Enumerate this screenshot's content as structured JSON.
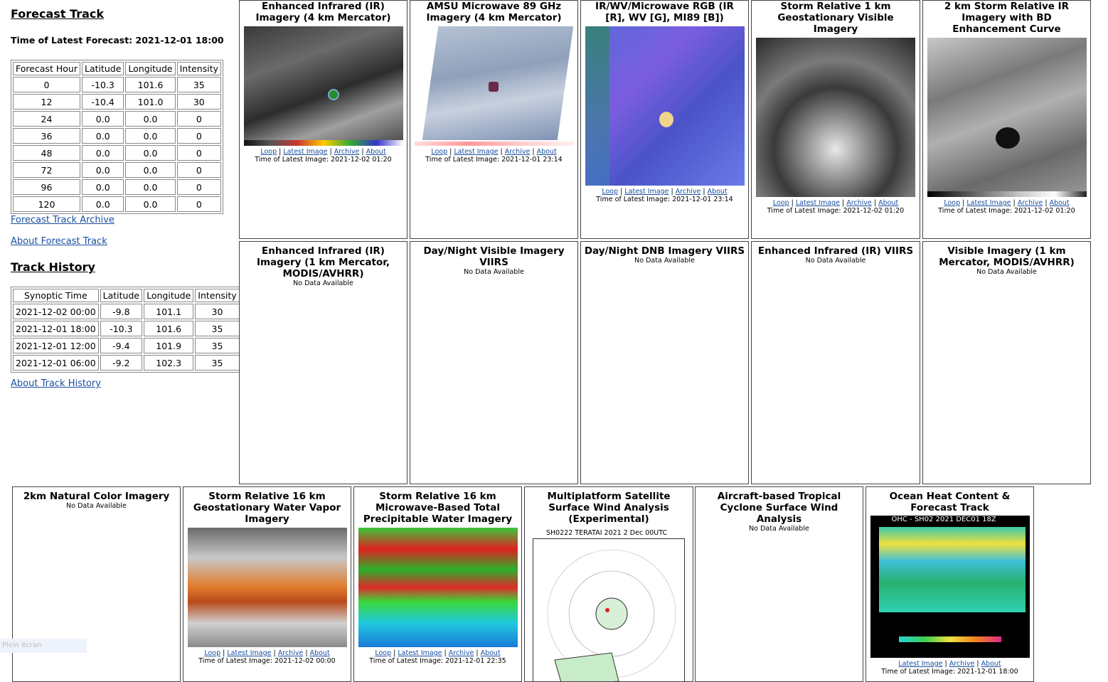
{
  "forecast": {
    "heading": "Forecast Track",
    "time_label": "Time of Latest Forecast: 2021-12-01 18:00",
    "columns": [
      "Forecast Hour",
      "Latitude",
      "Longitude",
      "Intensity"
    ],
    "rows": [
      [
        "0",
        "-10.3",
        "101.6",
        "35"
      ],
      [
        "12",
        "-10.4",
        "101.0",
        "30"
      ],
      [
        "24",
        "0.0",
        "0.0",
        "0"
      ],
      [
        "36",
        "0.0",
        "0.0",
        "0"
      ],
      [
        "48",
        "0.0",
        "0.0",
        "0"
      ],
      [
        "72",
        "0.0",
        "0.0",
        "0"
      ],
      [
        "96",
        "0.0",
        "0.0",
        "0"
      ],
      [
        "120",
        "0.0",
        "0.0",
        "0"
      ]
    ],
    "archive_link": "Forecast Track Archive",
    "about_link": "About Forecast Track"
  },
  "history": {
    "heading": "Track History",
    "columns": [
      "Synoptic Time",
      "Latitude",
      "Longitude",
      "Intensity"
    ],
    "rows": [
      [
        "2021-12-02 00:00",
        "-9.8",
        "101.1",
        "30"
      ],
      [
        "2021-12-01 18:00",
        "-10.3",
        "101.6",
        "35"
      ],
      [
        "2021-12-01 12:00",
        "-9.4",
        "101.9",
        "35"
      ],
      [
        "2021-12-01 06:00",
        "-9.2",
        "102.3",
        "35"
      ]
    ],
    "about_link": "About Track History"
  },
  "links": {
    "loop": "Loop",
    "latest": "Latest Image",
    "archive": "Archive",
    "about": "About",
    "sep": "|"
  },
  "no_data": "No Data Available",
  "panels": [
    {
      "title": "Enhanced Infrared (IR) Imagery (4 km Mercator)",
      "time": "Time of Latest Image: 2021-12-02 01:20"
    },
    {
      "title": "AMSU Microwave 89 GHz Imagery (4 km Mercator)",
      "time": "Time of Latest Image: 2021-12-01 23:14"
    },
    {
      "title": "IR/WV/Microwave RGB (IR [R], WV [G], MI89 [B])",
      "time": "Time of Latest Image: 2021-12-01 23:14"
    },
    {
      "title": "Storm Relative 1 km Geostationary Visible Imagery",
      "time": "Time of Latest Image: 2021-12-02 01:20"
    },
    {
      "title": "2 km Storm Relative IR Imagery with BD Enhancement Curve",
      "time": "Time of Latest Image: 2021-12-02 01:20"
    },
    {
      "title": "Enhanced Infrared (IR) Imagery (1 km Mercator, MODIS/AVHRR)"
    },
    {
      "title": "Day/Night Visible Imagery VIIRS"
    },
    {
      "title": "Day/Night DNB Imagery VIIRS"
    },
    {
      "title": "Enhanced Infrared (IR) VIIRS"
    },
    {
      "title": "Visible Imagery (1 km Mercator, MODIS/AVHRR)"
    },
    {
      "title": "2km Natural Color Imagery"
    },
    {
      "title": "Storm Relative 16 km Geostationary Water Vapor Imagery",
      "time": "Time of Latest Image: 2021-12-02 00:00"
    },
    {
      "title": "Storm Relative 16 km Microwave-Based Total Precipitable Water Imagery",
      "time": "Time of Latest Image: 2021-12-01 22:35"
    },
    {
      "title": "Multiplatform Satellite Surface Wind Analysis (Experimental)",
      "caption": "SH0222    TERATAI  2021   2 Dec 00UTC"
    },
    {
      "title": "Aircraft-based Tropical Cyclone Surface Wind Analysis"
    },
    {
      "title": "Ocean Heat Content & Forecast Track",
      "caption": "OHC - SH02 2021 DEC01 18Z",
      "time": "Time of Latest Image: 2021-12-01 18:00"
    }
  ],
  "ghost_text": "Plein écran",
  "colors": {
    "link": "#1a4fa0",
    "border": "#444444"
  }
}
